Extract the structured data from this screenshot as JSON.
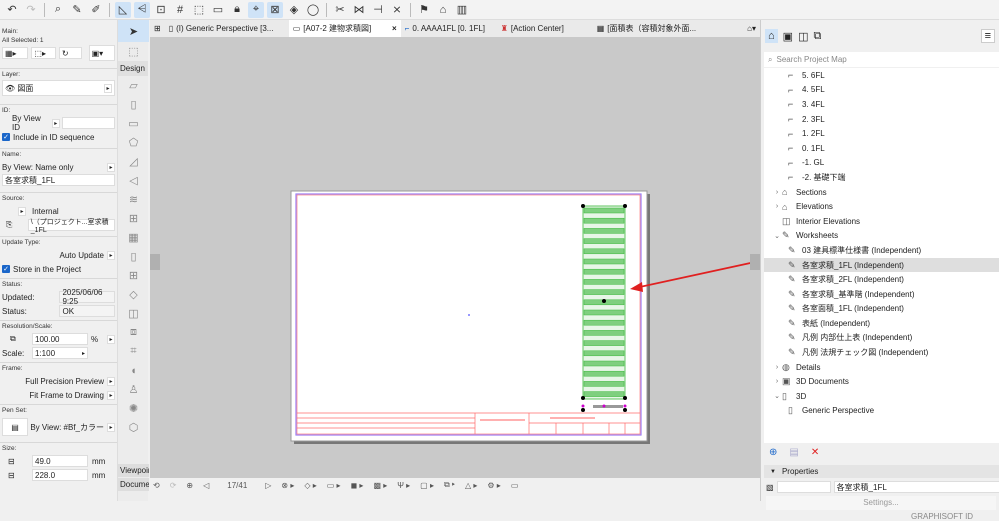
{
  "left_panel": {
    "main_label": "Main:",
    "all_selected": "All Selected: 1",
    "layer_label": "Layer:",
    "layer_value": "図面",
    "id_label": "ID:",
    "by_view_id": "By View ID",
    "include_id": "Include in ID sequence",
    "name_label": "Name:",
    "name_mode": "By View: Name only",
    "name_value": "各室求積_1FL",
    "source_label": "Source:",
    "source_type": "Internal",
    "source_path": "\\（プロジェクト...室求積_1FL",
    "update_label": "Update Type:",
    "update_value": "Auto Update",
    "store": "Store in the Project",
    "status_label": "Status:",
    "updated_label": "Updated:",
    "updated_value": "2025/06/06 9:25",
    "status_key": "Status:",
    "status_value": "OK",
    "res_label": "Resolution/Scale:",
    "res_value": "100.00",
    "res_unit": "%",
    "scale_label": "Scale:",
    "scale_value": "1:100",
    "frame_label": "Frame:",
    "frame_preview": "Full Precision Preview",
    "frame_fit": "Fit Frame to Drawing",
    "penset_label": "Pen Set:",
    "penset_value": "By View: #Bf_カラー",
    "size_label": "Size:",
    "width_value": "49.0",
    "height_value": "228.0",
    "unit": "mm"
  },
  "toolbox": {
    "design": "Design",
    "viewpoint": "Viewpoir",
    "document": "Documei"
  },
  "tabs": [
    {
      "label": "(I) Generic Perspective [3..."
    },
    {
      "label": "[A07-2 建物求積図]",
      "close": "×"
    },
    {
      "label": "0. AAAA1FL [0. 1FL]"
    },
    {
      "label": "[Action Center]"
    },
    {
      "label": "[面積表（容積対象外面..."
    }
  ],
  "bottom_bar": {
    "page": "17/41"
  },
  "project_map": {
    "search_placeholder": "Search Project Map",
    "items": [
      {
        "label": "5. 6FL",
        "level": 2,
        "icon": "story"
      },
      {
        "label": "4. 5FL",
        "level": 2,
        "icon": "story"
      },
      {
        "label": "3. 4FL",
        "level": 2,
        "icon": "story"
      },
      {
        "label": "2. 3FL",
        "level": 2,
        "icon": "story"
      },
      {
        "label": "1. 2FL",
        "level": 2,
        "icon": "story"
      },
      {
        "label": "0. 1FL",
        "level": 2,
        "icon": "story"
      },
      {
        "label": "-1. GL",
        "level": 2,
        "icon": "story"
      },
      {
        "label": "-2. 基礎下端",
        "level": 2,
        "icon": "story"
      },
      {
        "label": "Sections",
        "level": 1,
        "caret": "›",
        "icon": "section"
      },
      {
        "label": "Elevations",
        "level": 1,
        "caret": "›",
        "icon": "elevation"
      },
      {
        "label": "Interior Elevations",
        "level": 1,
        "icon": "interior"
      },
      {
        "label": "Worksheets",
        "level": 1,
        "caret": "⌄",
        "icon": "worksheet"
      },
      {
        "label": "03 建具標準仕様書 (Independent)",
        "level": 2,
        "icon": "worksheet"
      },
      {
        "label": "各室求積_1FL (Independent)",
        "level": 2,
        "icon": "worksheet",
        "selected": true
      },
      {
        "label": "各室求積_2FL (Independent)",
        "level": 2,
        "icon": "worksheet"
      },
      {
        "label": "各室求積_基準階 (Independent)",
        "level": 2,
        "icon": "worksheet"
      },
      {
        "label": "各室面積_1FL (Independent)",
        "level": 2,
        "icon": "worksheet"
      },
      {
        "label": "表紙 (Independent)",
        "level": 2,
        "icon": "worksheet"
      },
      {
        "label": "凡例 内部仕上表 (Independent)",
        "level": 2,
        "icon": "worksheet"
      },
      {
        "label": "凡例 法規チェック図 (Independent)",
        "level": 2,
        "icon": "worksheet"
      },
      {
        "label": "Details",
        "level": 1,
        "caret": "›",
        "icon": "detail"
      },
      {
        "label": "3D Documents",
        "level": 1,
        "caret": "›",
        "icon": "3ddoc"
      },
      {
        "label": "3D",
        "level": 1,
        "caret": "⌄",
        "icon": "3d"
      },
      {
        "label": "Generic Perspective",
        "level": 2,
        "icon": "3d"
      }
    ],
    "properties_label": "Properties",
    "properties_name": "各室求積_1FL",
    "settings": "Settings...",
    "graphisoft": "GRAPHISOFT ID"
  },
  "colors": {
    "accent": "#1a66c9",
    "arrow": "#e02020",
    "drawing": "#3cb83c",
    "titleblock": "#ff6060"
  }
}
